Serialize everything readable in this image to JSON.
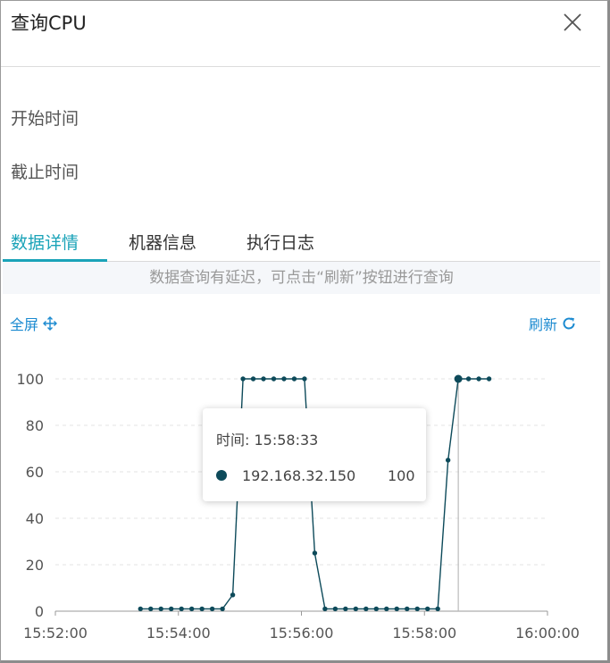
{
  "dialog": {
    "title": "查询CPU",
    "start_label": "开始时间",
    "end_label": "截止时间"
  },
  "tabs": [
    {
      "label": "数据详情",
      "active": true
    },
    {
      "label": "机器信息",
      "active": false
    },
    {
      "label": "执行日志",
      "active": false
    }
  ],
  "notice": "数据查询有延迟，可点击“刷新”按钮进行查询",
  "toolbar": {
    "fullscreen_label": "全屏",
    "fullscreen_icon": "move-arrows-icon",
    "refresh_label": "刷新",
    "refresh_icon": "refresh-icon"
  },
  "tooltip": {
    "time": "时间: 15:58:33",
    "series_name": "192.168.32.150",
    "value": "100"
  },
  "colors": {
    "accent": "#1aa3b8",
    "link": "#1b8ad0",
    "series": "#0d4a5a"
  },
  "chart_data": {
    "type": "line",
    "x_unit": "time (HH:MM:SS)",
    "xlim": [
      "15:52:00",
      "16:00:00"
    ],
    "ylim": [
      0,
      100
    ],
    "x_ticks": [
      "15:52:00",
      "15:54:00",
      "15:56:00",
      "15:58:00",
      "16:00:00"
    ],
    "y_ticks": [
      0,
      20,
      40,
      60,
      80,
      100
    ],
    "grid": "horizontal dashed",
    "series": [
      {
        "name": "192.168.32.150",
        "points": [
          [
            "15:53:23",
            1
          ],
          [
            "15:53:33",
            1
          ],
          [
            "15:53:43",
            1
          ],
          [
            "15:53:53",
            1
          ],
          [
            "15:54:03",
            1
          ],
          [
            "15:54:13",
            1
          ],
          [
            "15:54:23",
            1
          ],
          [
            "15:54:33",
            1
          ],
          [
            "15:54:43",
            1
          ],
          [
            "15:54:53",
            7
          ],
          [
            "15:55:03",
            100
          ],
          [
            "15:55:13",
            100
          ],
          [
            "15:55:23",
            100
          ],
          [
            "15:55:33",
            100
          ],
          [
            "15:55:43",
            100
          ],
          [
            "15:55:53",
            100
          ],
          [
            "15:56:03",
            100
          ],
          [
            "15:56:13",
            25
          ],
          [
            "15:56:23",
            1
          ],
          [
            "15:56:33",
            1
          ],
          [
            "15:56:43",
            1
          ],
          [
            "15:56:53",
            1
          ],
          [
            "15:57:03",
            1
          ],
          [
            "15:57:13",
            1
          ],
          [
            "15:57:23",
            1
          ],
          [
            "15:57:33",
            1
          ],
          [
            "15:57:43",
            1
          ],
          [
            "15:57:53",
            1
          ],
          [
            "15:58:03",
            1
          ],
          [
            "15:58:13",
            1
          ],
          [
            "15:58:23",
            65
          ],
          [
            "15:58:33",
            100
          ],
          [
            "15:58:43",
            100
          ],
          [
            "15:58:53",
            100
          ],
          [
            "15:59:03",
            100
          ]
        ]
      }
    ],
    "highlight": {
      "x": "15:58:33",
      "y": 100
    }
  }
}
